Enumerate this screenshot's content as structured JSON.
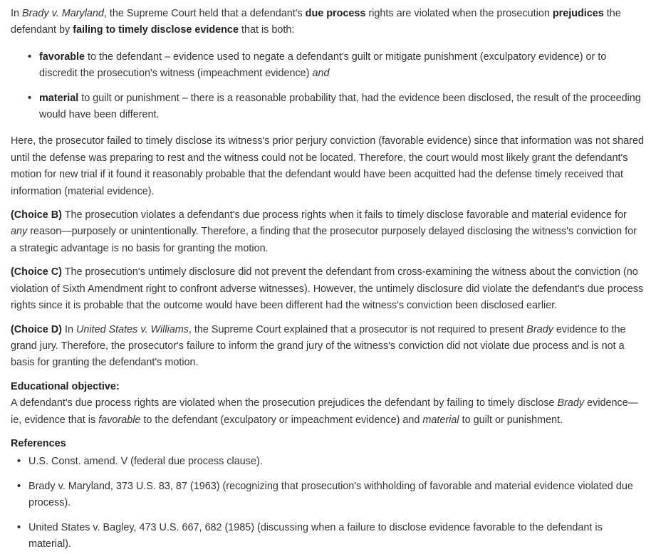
{
  "intro": {
    "t1": "In ",
    "case1": "Brady v. Maryland",
    "t2": ", the Supreme Court held that a defendant's ",
    "b1": "due process",
    "t3": " rights are violated when the prosecution ",
    "b2": "prejudices",
    "t4": " the defendant by ",
    "b3": "failing to timely disclose evidence",
    "t5": " that is both:"
  },
  "brady_elements": [
    {
      "bullet": "•",
      "term": "favorable",
      "text": " to the defendant – evidence used to negate a defendant's guilt or mitigate punishment (exculpatory evidence) or to discredit the prosecution's witness (impeachment evidence) ",
      "tail": "and"
    },
    {
      "bullet": "•",
      "term": "material",
      "text": " to guilt or punishment – there is a reasonable probability that, had the evidence been disclosed, the result of the proceeding would have been different.",
      "tail": ""
    }
  ],
  "analysis": "Here, the prosecutor failed to timely disclose its witness's prior perjury conviction (favorable evidence) since that information was not shared until the defense was preparing to rest and the witness could not be located.  Therefore, the court would most likely grant the defendant's motion for new trial if it found it reasonably probable that the defendant would have been acquitted had the defense timely received that information (material evidence).",
  "choice_b": {
    "label": "(Choice B)",
    "t1": "  The prosecution violates a defendant's due process rights when it fails to timely disclose favorable and material evidence for ",
    "em": "any",
    "t2": " reason—purposely or unintentionally.  Therefore, a finding that the prosecutor purposely delayed disclosing the witness's conviction for a strategic advantage is no basis for granting the motion."
  },
  "choice_c": {
    "label": "(Choice C)",
    "t1": "  The prosecution's untimely disclosure did not prevent the defendant from cross-examining the witness about the conviction (no violation of Sixth Amendment right to confront adverse witnesses).  However, the untimely disclosure did violate the defendant's due process rights since it is probable that the outcome would have been different had the witness's conviction been disclosed earlier."
  },
  "choice_d": {
    "label": "(Choice D)",
    "t1": "  In ",
    "case1": "United States v. Williams",
    "t2": ", the Supreme Court explained that a prosecutor is not required to present ",
    "case2": "Brady",
    "t3": " evidence to the grand jury.  Therefore, the prosecutor's failure to inform the grand jury of the witness's conviction did not violate due process and is not a basis for granting the defendant's motion."
  },
  "objective": {
    "heading": "Educational objective:",
    "t1": "A defendant's due process rights are violated when the prosecution prejudices the defendant by failing to timely disclose ",
    "em1": "Brady",
    "t2": " evidence—ie, evidence that is ",
    "em2": "favorable",
    "t3": " to the defendant (exculpatory or impeachment evidence) and ",
    "em3": "material",
    "t4": " to guilt or punishment."
  },
  "references": {
    "heading": "References",
    "items": [
      {
        "bullet": "•",
        "text": "U.S. Const. amend. V (federal due process clause)."
      },
      {
        "bullet": "•",
        "text": "Brady v. Maryland, 373 U.S. 83, 87 (1963) (recognizing that prosecution's withholding of favorable and material evidence violated due process)."
      },
      {
        "bullet": "•",
        "text": "United States v. Bagley, 473 U.S. 667, 682 (1985) (discussing when a failure to disclose evidence favorable to the defendant is material)."
      }
    ]
  }
}
